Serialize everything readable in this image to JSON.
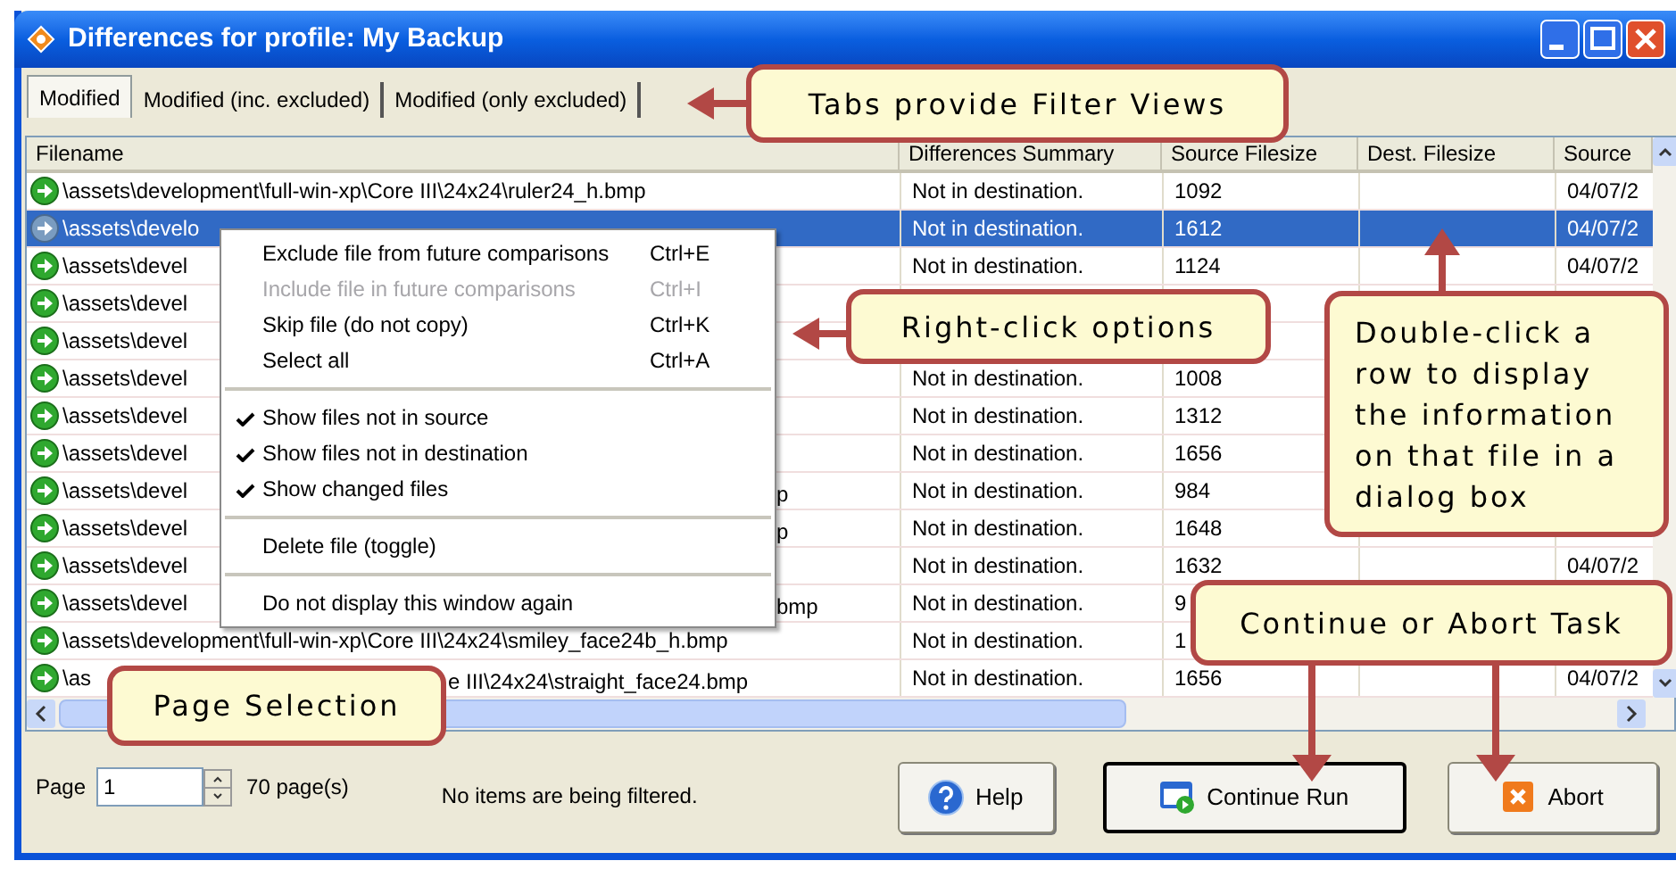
{
  "window": {
    "title": "Differences for profile: My Backup"
  },
  "tabs": [
    {
      "label": "Modified",
      "selected": true
    },
    {
      "label": "Modified (inc. excluded)",
      "selected": false
    },
    {
      "label": "Modified (only excluded)",
      "selected": false
    }
  ],
  "table": {
    "columns": [
      "Filename",
      "Differences Summary",
      "Source Filesize",
      "Dest. Filesize",
      "Source"
    ],
    "rows": [
      {
        "filename": "\\assets\\development\\full-win-xp\\Core III\\24x24\\ruler24_h.bmp",
        "summary": "Not in destination.",
        "source_size": "1092",
        "source_date": "04/07/2",
        "selected": false
      },
      {
        "filename": "\\assets\\develo",
        "summary": "Not in destination.",
        "source_size": "1612",
        "source_date": "04/07/2",
        "selected": true
      },
      {
        "filename": "\\assets\\devel",
        "summary": "Not in destination.",
        "source_size": "1124",
        "source_date": "04/07/2",
        "selected": false
      },
      {
        "filename": "\\assets\\devel",
        "selected": false
      },
      {
        "filename": "\\assets\\devel",
        "selected": false
      },
      {
        "filename": "\\assets\\devel",
        "summary": "Not in destination.",
        "source_size": "1008",
        "selected": false
      },
      {
        "filename": "\\assets\\devel",
        "summary": "Not in destination.",
        "source_size": "1312",
        "selected": false
      },
      {
        "filename": "\\assets\\devel",
        "summary": "Not in destination.",
        "source_size": "1656",
        "selected": false
      },
      {
        "filename": "\\assets\\devel",
        "filename_tail": "p",
        "summary": "Not in destination.",
        "source_size": "984",
        "selected": false
      },
      {
        "filename": "\\assets\\devel",
        "filename_tail": "p",
        "summary": "Not in destination.",
        "source_size": "1648",
        "selected": false
      },
      {
        "filename": "\\assets\\devel",
        "summary": "Not in destination.",
        "source_size": "1632",
        "source_date": "04/07/2",
        "selected": false
      },
      {
        "filename": "\\assets\\devel",
        "filename_tail": "bmp",
        "summary": "Not in destination.",
        "source_size": "9",
        "selected": false
      },
      {
        "filename": "\\assets\\development\\full-win-xp\\Core III\\24x24\\smiley_face24b_h.bmp",
        "summary": "Not in destination.",
        "source_size": "1",
        "selected": false
      },
      {
        "filename": "\\as",
        "filename_after_callout": "e III\\24x24\\straight_face24.bmp",
        "summary": "Not in destination.",
        "source_size": "1656",
        "source_date": "04/07/2",
        "selected": false
      }
    ]
  },
  "context_menu": {
    "items": [
      {
        "kind": "item",
        "label": "Exclude file from future comparisons",
        "shortcut": "Ctrl+E",
        "disabled": false,
        "checked": false
      },
      {
        "kind": "item",
        "label": "Include file in future comparisons",
        "shortcut": "Ctrl+I",
        "disabled": true,
        "checked": false
      },
      {
        "kind": "item",
        "label": "Skip file (do not copy)",
        "shortcut": "Ctrl+K",
        "disabled": false,
        "checked": false
      },
      {
        "kind": "item",
        "label": "Select all",
        "shortcut": "Ctrl+A",
        "disabled": false,
        "checked": false
      },
      {
        "kind": "separator"
      },
      {
        "kind": "item",
        "label": "Show files not in source",
        "disabled": false,
        "checked": true
      },
      {
        "kind": "item",
        "label": "Show files not in destination",
        "disabled": false,
        "checked": true
      },
      {
        "kind": "item",
        "label": "Show changed files",
        "disabled": false,
        "checked": true
      },
      {
        "kind": "separator"
      },
      {
        "kind": "item",
        "label": "Delete file (toggle)",
        "disabled": false,
        "checked": false
      },
      {
        "kind": "separator"
      },
      {
        "kind": "item",
        "label": "Do not display this window again",
        "disabled": false,
        "checked": false
      }
    ]
  },
  "footer": {
    "page_label": "Page",
    "page_value": "1",
    "page_count": "70 page(s)",
    "filter_status": "No items are being filtered.",
    "buttons": [
      {
        "kind": "help",
        "label": "Help",
        "default": false
      },
      {
        "kind": "continue",
        "label": "Continue Run",
        "default": true
      },
      {
        "kind": "abort",
        "label": "Abort",
        "default": false
      }
    ]
  },
  "callouts": [
    {
      "text": "Tabs provide Filter Views"
    },
    {
      "text": "Right-click options"
    },
    {
      "text": "Double-click a row to display the information on that file in a dialog box"
    },
    {
      "text": "Continue or Abort Task"
    },
    {
      "text": "Page Selection"
    }
  ]
}
